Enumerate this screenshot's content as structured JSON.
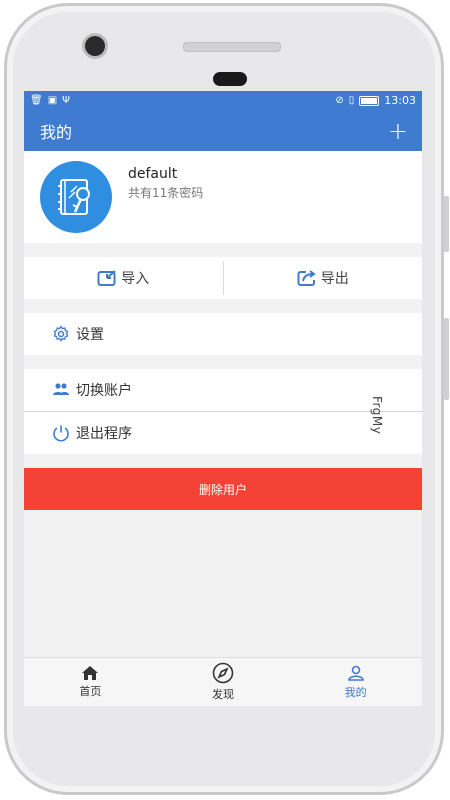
{
  "statusbar": {
    "time": "13:03",
    "left_icons": [
      "trash-icon",
      "image-icon",
      "usb-icon"
    ],
    "right_icons": [
      "no-sim-icon",
      "sim-icon",
      "battery-icon"
    ]
  },
  "appbar": {
    "title": "我的",
    "add_label": "+"
  },
  "profile": {
    "username": "default",
    "password_count": "共有11条密码"
  },
  "actions": {
    "import_label": "导入",
    "export_label": "导出"
  },
  "menu": {
    "settings_label": "设置",
    "switch_account_label": "切换账户",
    "exit_label": "退出程序"
  },
  "delete_label": "删除用户",
  "watermark": "FrgMy",
  "nav": {
    "home_label": "首页",
    "discover_label": "发现",
    "mine_label": "我的"
  },
  "colors": {
    "primary": "#3f7bd0",
    "danger": "#f44336",
    "avatar": "#2f8ee0"
  }
}
